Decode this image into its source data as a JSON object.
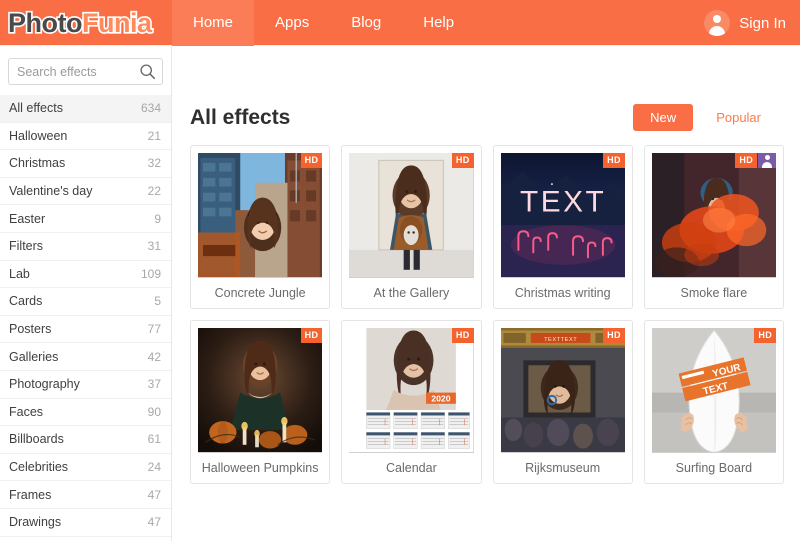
{
  "colors": {
    "brand_orange": "#fa6e46",
    "brand_orange_light": "#fb7d57",
    "badge_hd": "#f4622e",
    "badge_person": "#7b5ba8",
    "sidebar_border": "#e8e8e8",
    "card_border": "#e4e4e4",
    "text_dark": "#2f2f2f",
    "text_muted": "#a8a8a8"
  },
  "header": {
    "logo_part1": "Photo",
    "logo_part2": "Funia",
    "nav": [
      {
        "label": "Home",
        "active": true
      },
      {
        "label": "Apps",
        "active": false
      },
      {
        "label": "Blog",
        "active": false
      },
      {
        "label": "Help",
        "active": false
      }
    ],
    "signin_label": "Sign In",
    "avatar_icon": "user-avatar-icon"
  },
  "sidebar": {
    "search": {
      "placeholder": "Search effects",
      "value": "",
      "icon": "search-icon"
    },
    "categories": [
      {
        "label": "All effects",
        "count": "634",
        "active": true
      },
      {
        "label": "Halloween",
        "count": "21",
        "active": false
      },
      {
        "label": "Christmas",
        "count": "32",
        "active": false
      },
      {
        "label": "Valentine's day",
        "count": "22",
        "active": false
      },
      {
        "label": "Easter",
        "count": "9",
        "active": false
      },
      {
        "label": "Filters",
        "count": "31",
        "active": false
      },
      {
        "label": "Lab",
        "count": "109",
        "active": false
      },
      {
        "label": "Cards",
        "count": "5",
        "active": false
      },
      {
        "label": "Posters",
        "count": "77",
        "active": false
      },
      {
        "label": "Galleries",
        "count": "42",
        "active": false
      },
      {
        "label": "Photography",
        "count": "37",
        "active": false
      },
      {
        "label": "Faces",
        "count": "90",
        "active": false
      },
      {
        "label": "Billboards",
        "count": "61",
        "active": false
      },
      {
        "label": "Celebrities",
        "count": "24",
        "active": false
      },
      {
        "label": "Frames",
        "count": "47",
        "active": false
      },
      {
        "label": "Drawings",
        "count": "47",
        "active": false
      }
    ]
  },
  "main": {
    "title": "All effects",
    "toggles": [
      {
        "label": "New",
        "active": true
      },
      {
        "label": "Popular",
        "active": false
      }
    ],
    "effects": [
      {
        "title": "Concrete Jungle",
        "hd": true,
        "person": false,
        "art": "concrete-jungle"
      },
      {
        "title": "At the Gallery",
        "hd": true,
        "person": false,
        "art": "at-the-gallery"
      },
      {
        "title": "Christmas writing",
        "hd": true,
        "person": false,
        "art": "christmas-writing",
        "overlay_text": "TEXT"
      },
      {
        "title": "Smoke flare",
        "hd": true,
        "person": true,
        "art": "smoke-flare"
      },
      {
        "title": "Halloween Pumpkins",
        "hd": true,
        "person": false,
        "art": "halloween-pumpkins"
      },
      {
        "title": "Calendar",
        "hd": true,
        "person": false,
        "art": "calendar",
        "overlay_text": "2020"
      },
      {
        "title": "Rijksmuseum",
        "hd": true,
        "person": false,
        "art": "rijksmuseum"
      },
      {
        "title": "Surfing Board",
        "hd": true,
        "person": false,
        "art": "surfing-board",
        "overlay_text": "YOUR TEXT"
      }
    ],
    "badge_hd_label": "HD"
  }
}
